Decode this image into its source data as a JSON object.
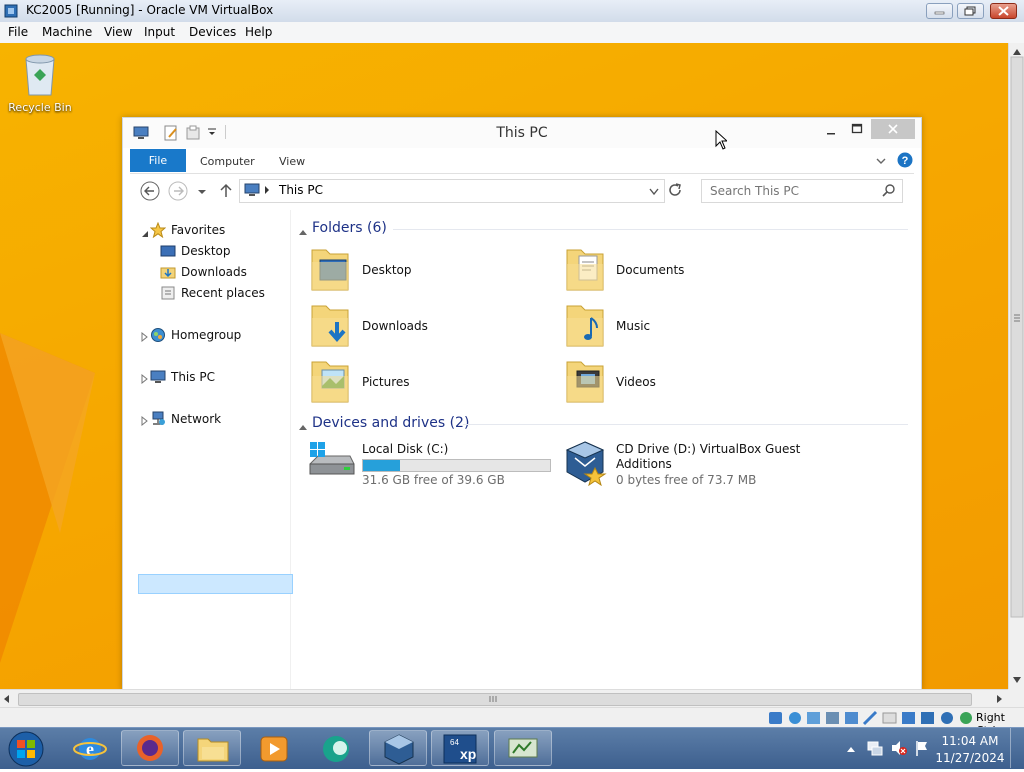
{
  "host": {
    "title": "KC2005 [Running] - Oracle VM VirtualBox",
    "menu": [
      "File",
      "Machine",
      "View",
      "Input",
      "Devices",
      "Help"
    ],
    "host_key_label": "Right Ctrl"
  },
  "desktop": {
    "recycle_bin_label": "Recycle Bin"
  },
  "explorer": {
    "title": "This PC",
    "ribbon_tabs": [
      "File",
      "Computer",
      "View"
    ],
    "address_path": "This PC",
    "search_placeholder": "Search This PC",
    "nav": {
      "favorites": "Favorites",
      "favorites_items": [
        "Desktop",
        "Downloads",
        "Recent places"
      ],
      "homegroup": "Homegroup",
      "this_pc": "This PC",
      "network": "Network"
    },
    "folders_heading": "Folders (6)",
    "folders": [
      "Desktop",
      "Documents",
      "Downloads",
      "Music",
      "Pictures",
      "Videos"
    ],
    "drives_heading": "Devices and drives (2)",
    "drives": [
      {
        "name": "Local Disk (C:)",
        "free_text": "31.6 GB free of 39.6 GB",
        "used_fraction": 0.2
      },
      {
        "name_line1": "CD Drive (D:) VirtualBox Guest",
        "name_line2": "Additions",
        "free_text": "0 bytes free of 73.7 MB"
      }
    ]
  },
  "taskbar": {
    "clock_time": "11:04 AM",
    "clock_date": "11/27/2024",
    "pinned": [
      "start-orb",
      "internet-explorer",
      "firefox",
      "file-explorer",
      "media-player",
      "app-teal",
      "virtualbox",
      "windows-xp-mode",
      "network-monitor"
    ]
  },
  "colors": {
    "desktop": "#f6a700",
    "ribbon_file_tab": "#1979ca",
    "selection": "#cce8ff",
    "group_heading": "#1e3287",
    "progress": "#26a0da"
  }
}
